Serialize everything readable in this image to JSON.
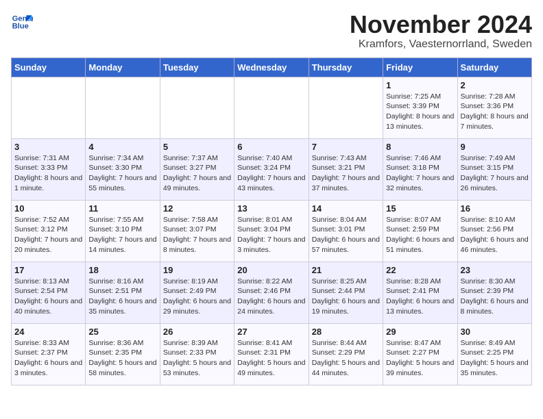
{
  "header": {
    "logo_line1": "General",
    "logo_line2": "Blue",
    "month_title": "November 2024",
    "subtitle": "Kramfors, Vaesternorrland, Sweden"
  },
  "days_of_week": [
    "Sunday",
    "Monday",
    "Tuesday",
    "Wednesday",
    "Thursday",
    "Friday",
    "Saturday"
  ],
  "weeks": [
    [
      {
        "day": "",
        "info": ""
      },
      {
        "day": "",
        "info": ""
      },
      {
        "day": "",
        "info": ""
      },
      {
        "day": "",
        "info": ""
      },
      {
        "day": "",
        "info": ""
      },
      {
        "day": "1",
        "info": "Sunrise: 7:25 AM\nSunset: 3:39 PM\nDaylight: 8 hours and 13 minutes."
      },
      {
        "day": "2",
        "info": "Sunrise: 7:28 AM\nSunset: 3:36 PM\nDaylight: 8 hours and 7 minutes."
      }
    ],
    [
      {
        "day": "3",
        "info": "Sunrise: 7:31 AM\nSunset: 3:33 PM\nDaylight: 8 hours and 1 minute."
      },
      {
        "day": "4",
        "info": "Sunrise: 7:34 AM\nSunset: 3:30 PM\nDaylight: 7 hours and 55 minutes."
      },
      {
        "day": "5",
        "info": "Sunrise: 7:37 AM\nSunset: 3:27 PM\nDaylight: 7 hours and 49 minutes."
      },
      {
        "day": "6",
        "info": "Sunrise: 7:40 AM\nSunset: 3:24 PM\nDaylight: 7 hours and 43 minutes."
      },
      {
        "day": "7",
        "info": "Sunrise: 7:43 AM\nSunset: 3:21 PM\nDaylight: 7 hours and 37 minutes."
      },
      {
        "day": "8",
        "info": "Sunrise: 7:46 AM\nSunset: 3:18 PM\nDaylight: 7 hours and 32 minutes."
      },
      {
        "day": "9",
        "info": "Sunrise: 7:49 AM\nSunset: 3:15 PM\nDaylight: 7 hours and 26 minutes."
      }
    ],
    [
      {
        "day": "10",
        "info": "Sunrise: 7:52 AM\nSunset: 3:12 PM\nDaylight: 7 hours and 20 minutes."
      },
      {
        "day": "11",
        "info": "Sunrise: 7:55 AM\nSunset: 3:10 PM\nDaylight: 7 hours and 14 minutes."
      },
      {
        "day": "12",
        "info": "Sunrise: 7:58 AM\nSunset: 3:07 PM\nDaylight: 7 hours and 8 minutes."
      },
      {
        "day": "13",
        "info": "Sunrise: 8:01 AM\nSunset: 3:04 PM\nDaylight: 7 hours and 3 minutes."
      },
      {
        "day": "14",
        "info": "Sunrise: 8:04 AM\nSunset: 3:01 PM\nDaylight: 6 hours and 57 minutes."
      },
      {
        "day": "15",
        "info": "Sunrise: 8:07 AM\nSunset: 2:59 PM\nDaylight: 6 hours and 51 minutes."
      },
      {
        "day": "16",
        "info": "Sunrise: 8:10 AM\nSunset: 2:56 PM\nDaylight: 6 hours and 46 minutes."
      }
    ],
    [
      {
        "day": "17",
        "info": "Sunrise: 8:13 AM\nSunset: 2:54 PM\nDaylight: 6 hours and 40 minutes."
      },
      {
        "day": "18",
        "info": "Sunrise: 8:16 AM\nSunset: 2:51 PM\nDaylight: 6 hours and 35 minutes."
      },
      {
        "day": "19",
        "info": "Sunrise: 8:19 AM\nSunset: 2:49 PM\nDaylight: 6 hours and 29 minutes."
      },
      {
        "day": "20",
        "info": "Sunrise: 8:22 AM\nSunset: 2:46 PM\nDaylight: 6 hours and 24 minutes."
      },
      {
        "day": "21",
        "info": "Sunrise: 8:25 AM\nSunset: 2:44 PM\nDaylight: 6 hours and 19 minutes."
      },
      {
        "day": "22",
        "info": "Sunrise: 8:28 AM\nSunset: 2:41 PM\nDaylight: 6 hours and 13 minutes."
      },
      {
        "day": "23",
        "info": "Sunrise: 8:30 AM\nSunset: 2:39 PM\nDaylight: 6 hours and 8 minutes."
      }
    ],
    [
      {
        "day": "24",
        "info": "Sunrise: 8:33 AM\nSunset: 2:37 PM\nDaylight: 6 hours and 3 minutes."
      },
      {
        "day": "25",
        "info": "Sunrise: 8:36 AM\nSunset: 2:35 PM\nDaylight: 5 hours and 58 minutes."
      },
      {
        "day": "26",
        "info": "Sunrise: 8:39 AM\nSunset: 2:33 PM\nDaylight: 5 hours and 53 minutes."
      },
      {
        "day": "27",
        "info": "Sunrise: 8:41 AM\nSunset: 2:31 PM\nDaylight: 5 hours and 49 minutes."
      },
      {
        "day": "28",
        "info": "Sunrise: 8:44 AM\nSunset: 2:29 PM\nDaylight: 5 hours and 44 minutes."
      },
      {
        "day": "29",
        "info": "Sunrise: 8:47 AM\nSunset: 2:27 PM\nDaylight: 5 hours and 39 minutes."
      },
      {
        "day": "30",
        "info": "Sunrise: 8:49 AM\nSunset: 2:25 PM\nDaylight: 5 hours and 35 minutes."
      }
    ]
  ]
}
